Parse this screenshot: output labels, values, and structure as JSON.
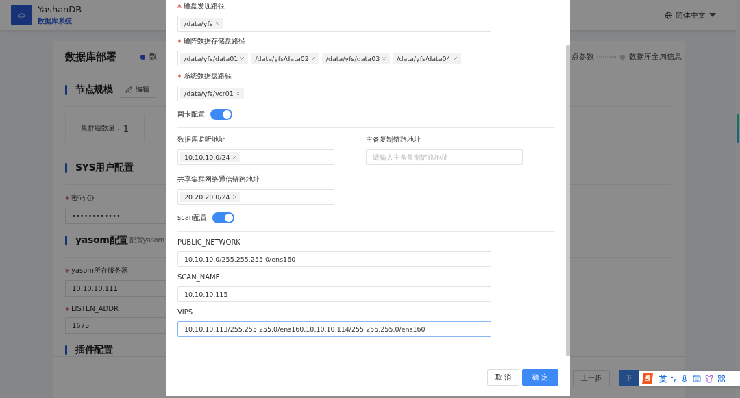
{
  "header": {
    "title": "YashanDB",
    "subtitle": "数据库系统",
    "language": "简体中文"
  },
  "page": {
    "title": "数据库部署",
    "steps_left": [
      {
        "label": "数",
        "active": true
      }
    ],
    "steps_right": [
      {
        "label": "点参数"
      },
      {
        "label": "数据库全局信息",
        "active": false
      }
    ],
    "node_scale": {
      "title": "节点规模",
      "edit_button": "编辑",
      "count_label": "集群组数量：",
      "count": "1"
    },
    "sys_user": {
      "title": "SYS用户配置",
      "field": {
        "label": "密码",
        "required": true,
        "value": "••••••••••••"
      }
    },
    "yasom": {
      "title": "yasom配置",
      "hint": "配置yasom",
      "fields": [
        {
          "label": "yasom所在服务器",
          "required": true,
          "value": "10.10.10.111"
        },
        {
          "label": "LISTEN_ADDR",
          "required": true,
          "value": "1675"
        }
      ]
    },
    "plugin": {
      "title": "插件配置"
    },
    "footer_buttons": [
      {
        "label": "上一步",
        "kind": "secondary"
      },
      {
        "label": "下",
        "kind": "primary"
      }
    ]
  },
  "modal": {
    "rows": [
      {
        "kind": "tags",
        "label": "磁盘发现路径",
        "required": true,
        "tags": [
          "/data/yfs"
        ]
      },
      {
        "kind": "tags",
        "label": "磁阵数据存储盘路径",
        "required": true,
        "tags": [
          "/data/yfs/data01",
          "/data/yfs/data02",
          "/data/yfs/data03",
          "/data/yfs/data04"
        ]
      },
      {
        "kind": "tags",
        "label": "系统数据盘路径",
        "required": true,
        "tags": [
          "/data/yfs/ycr01"
        ]
      },
      {
        "kind": "switch",
        "label": "网卡配置",
        "on": true
      },
      {
        "kind": "pair",
        "items": [
          {
            "kind": "tags",
            "label": "数据库监听地址",
            "tags": [
              "10.10.10.0/24"
            ]
          },
          {
            "kind": "input",
            "label": "主备复制链路地址",
            "placeholder": "请输入主备复制链路地址"
          }
        ]
      },
      {
        "kind": "tags",
        "label": "共享集群网络通信链路地址",
        "tags": [
          "20.20.20.0/24"
        ],
        "half": true
      },
      {
        "kind": "switch",
        "label": "scan配置",
        "on": true
      },
      {
        "kind": "input",
        "label": "PUBLIC_NETWORK",
        "value": "10.10.10.0/255.255.255.0/ens160",
        "focused": false
      },
      {
        "kind": "input",
        "label": "SCAN_NAME",
        "value": "10.10.10.115",
        "focused": false
      },
      {
        "kind": "input",
        "label": "VIPS",
        "value": "10.10.10.113/255.255.255.0/ens160,10.10.10.114/255.255.255.0/ens160",
        "focused": true
      }
    ],
    "buttons": [
      {
        "label": "取 消",
        "kind": "secondary"
      },
      {
        "label": "确 定",
        "kind": "primary"
      }
    ]
  },
  "ime": {
    "mode": "英"
  }
}
